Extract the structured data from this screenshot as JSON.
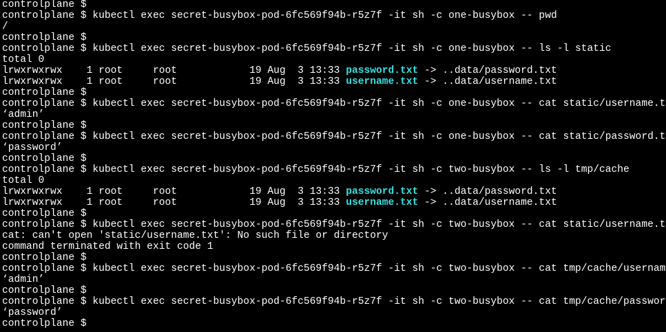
{
  "terminal": {
    "lines": [
      {
        "segments": [
          {
            "text": "controlplane $ ",
            "style": "plain"
          }
        ]
      },
      {
        "segments": [
          {
            "text": "controlplane $ kubectl exec secret-busybox-pod-6fc569f94b-r5z7f -it sh -c one-busybox -- pwd",
            "style": "plain"
          }
        ]
      },
      {
        "segments": [
          {
            "text": "/",
            "style": "plain"
          }
        ]
      },
      {
        "segments": [
          {
            "text": "controlplane $ ",
            "style": "plain"
          }
        ]
      },
      {
        "segments": [
          {
            "text": "controlplane $ kubectl exec secret-busybox-pod-6fc569f94b-r5z7f -it sh -c one-busybox -- ls -l static",
            "style": "plain"
          }
        ]
      },
      {
        "segments": [
          {
            "text": "total 0",
            "style": "plain"
          }
        ]
      },
      {
        "segments": [
          {
            "text": "lrwxrwxrwx    1 root     root            19 Aug  3 13:33 ",
            "style": "plain"
          },
          {
            "text": "password.txt",
            "style": "link"
          },
          {
            "text": " -> ..data/password.txt",
            "style": "plain"
          }
        ]
      },
      {
        "segments": [
          {
            "text": "lrwxrwxrwx    1 root     root            19 Aug  3 13:33 ",
            "style": "plain"
          },
          {
            "text": "username.txt",
            "style": "link"
          },
          {
            "text": " -> ..data/username.txt",
            "style": "plain"
          }
        ]
      },
      {
        "segments": [
          {
            "text": "controlplane $ ",
            "style": "plain"
          }
        ]
      },
      {
        "segments": [
          {
            "text": "controlplane $ kubectl exec secret-busybox-pod-6fc569f94b-r5z7f -it sh -c one-busybox -- cat static/username.txt",
            "style": "plain"
          }
        ]
      },
      {
        "segments": [
          {
            "text": "‘admin’",
            "style": "plain"
          }
        ]
      },
      {
        "segments": [
          {
            "text": "controlplane $ ",
            "style": "plain"
          }
        ]
      },
      {
        "segments": [
          {
            "text": "controlplane $ kubectl exec secret-busybox-pod-6fc569f94b-r5z7f -it sh -c one-busybox -- cat static/password.txt",
            "style": "plain"
          }
        ]
      },
      {
        "segments": [
          {
            "text": "‘password’",
            "style": "plain"
          }
        ]
      },
      {
        "segments": [
          {
            "text": "controlplane $ ",
            "style": "plain"
          }
        ]
      },
      {
        "segments": [
          {
            "text": "controlplane $ kubectl exec secret-busybox-pod-6fc569f94b-r5z7f -it sh -c two-busybox -- ls -l tmp/cache",
            "style": "plain"
          }
        ]
      },
      {
        "segments": [
          {
            "text": "total 0",
            "style": "plain"
          }
        ]
      },
      {
        "segments": [
          {
            "text": "lrwxrwxrwx    1 root     root            19 Aug  3 13:33 ",
            "style": "plain"
          },
          {
            "text": "password.txt",
            "style": "link"
          },
          {
            "text": " -> ..data/password.txt",
            "style": "plain"
          }
        ]
      },
      {
        "segments": [
          {
            "text": "lrwxrwxrwx    1 root     root            19 Aug  3 13:33 ",
            "style": "plain"
          },
          {
            "text": "username.txt",
            "style": "link"
          },
          {
            "text": " -> ..data/username.txt",
            "style": "plain"
          }
        ]
      },
      {
        "segments": [
          {
            "text": "controlplane $ ",
            "style": "plain"
          }
        ]
      },
      {
        "segments": [
          {
            "text": "controlplane $ kubectl exec secret-busybox-pod-6fc569f94b-r5z7f -it sh -c two-busybox -- cat static/username.txt",
            "style": "plain"
          }
        ]
      },
      {
        "segments": [
          {
            "text": "cat: can't open 'static/username.txt': No such file or directory",
            "style": "plain"
          }
        ]
      },
      {
        "segments": [
          {
            "text": "command terminated with exit code 1",
            "style": "plain"
          }
        ]
      },
      {
        "segments": [
          {
            "text": "controlplane $ ",
            "style": "plain"
          }
        ]
      },
      {
        "segments": [
          {
            "text": "controlplane $ kubectl exec secret-busybox-pod-6fc569f94b-r5z7f -it sh -c two-busybox -- cat tmp/cache/username.txt",
            "style": "plain"
          }
        ]
      },
      {
        "segments": [
          {
            "text": "‘admin’",
            "style": "plain"
          }
        ]
      },
      {
        "segments": [
          {
            "text": "controlplane $ ",
            "style": "plain"
          }
        ]
      },
      {
        "segments": [
          {
            "text": "controlplane $ kubectl exec secret-busybox-pod-6fc569f94b-r5z7f -it sh -c two-busybox -- cat tmp/cache/password.txt",
            "style": "plain"
          }
        ]
      },
      {
        "segments": [
          {
            "text": "‘password’",
            "style": "plain"
          }
        ]
      },
      {
        "segments": [
          {
            "text": "controlplane $ ",
            "style": "plain"
          }
        ]
      }
    ],
    "colors": {
      "background": "#000000",
      "foreground": "#ffffff",
      "symlink": "#34e2e2"
    }
  }
}
